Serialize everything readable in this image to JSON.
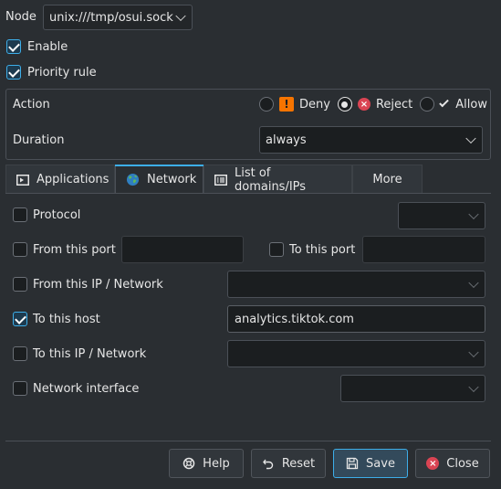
{
  "node": {
    "label": "Node",
    "value": "unix:///tmp/osui.sock"
  },
  "enable": {
    "label": "Enable",
    "checked": true
  },
  "priority": {
    "label": "Priority rule",
    "checked": true
  },
  "action": {
    "label": "Action",
    "options": [
      {
        "label": "Deny",
        "icon": "warning-icon",
        "selected": false
      },
      {
        "label": "Reject",
        "icon": "reject-icon",
        "selected": true
      },
      {
        "label": "Allow",
        "icon": "checkmark-icon",
        "selected": false
      }
    ]
  },
  "duration": {
    "label": "Duration",
    "value": "always"
  },
  "tabs": [
    {
      "label": "Applications",
      "icon": "application-icon",
      "active": false
    },
    {
      "label": "Network",
      "icon": "globe-icon",
      "active": true
    },
    {
      "label": "List of domains/IPs",
      "icon": "list-icon",
      "active": false
    },
    {
      "label": "More",
      "icon": "",
      "active": false
    }
  ],
  "network": {
    "protocol": {
      "label": "Protocol",
      "checked": false,
      "value": ""
    },
    "from_port": {
      "label": "From this port",
      "checked": false,
      "value": ""
    },
    "to_port": {
      "label": "To this port",
      "checked": false,
      "value": ""
    },
    "from_ip": {
      "label": "From this IP / Network",
      "checked": false,
      "value": ""
    },
    "to_host": {
      "label": "To this host",
      "checked": true,
      "value": "analytics.tiktok.com"
    },
    "to_ip": {
      "label": "To this IP / Network",
      "checked": false,
      "value": ""
    },
    "iface": {
      "label": "Network interface",
      "checked": false,
      "value": ""
    }
  },
  "buttons": {
    "help": "Help",
    "reset": "Reset",
    "save": "Save",
    "close": "Close"
  },
  "colors": {
    "accent": "#3daee9",
    "deny": "#f67400",
    "reject": "#da4453"
  }
}
